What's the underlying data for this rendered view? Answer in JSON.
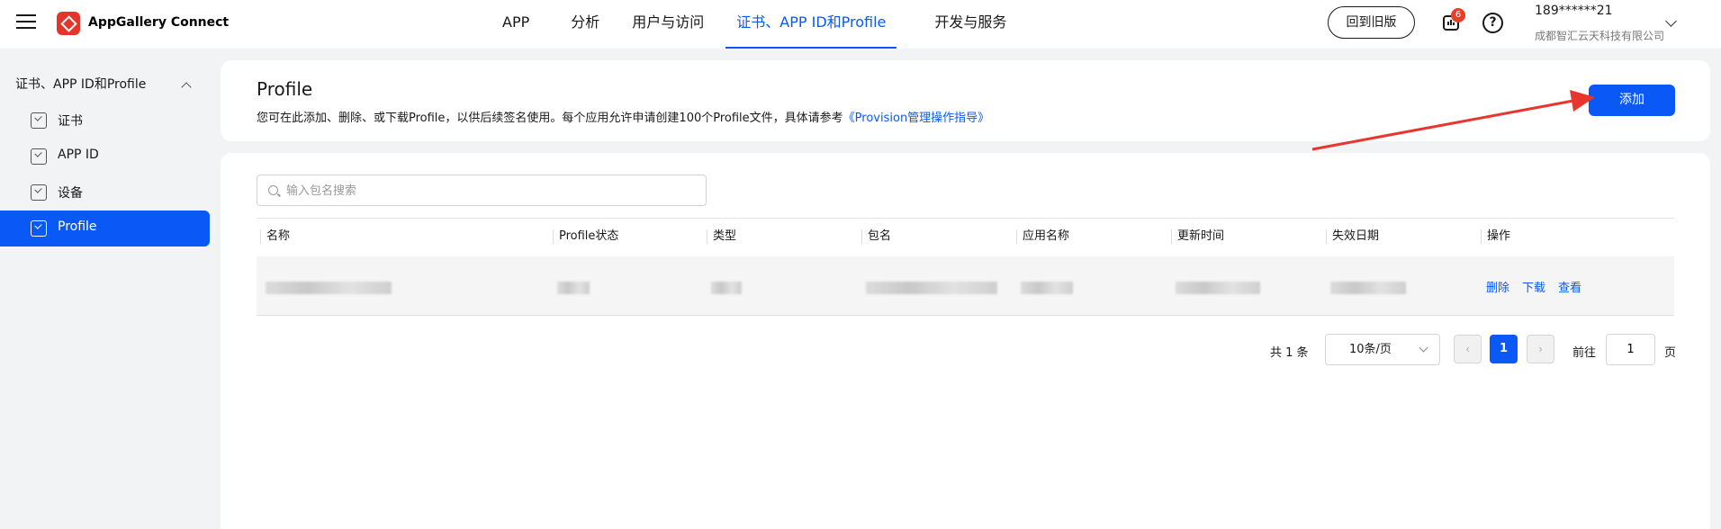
{
  "header": {
    "brand": "AppGallery Connect",
    "nav": [
      "APP",
      "分析",
      "用户与访问",
      "证书、APP ID和Profile",
      "开发与服务"
    ],
    "active_nav_index": 3,
    "old_version_label": "回到旧版",
    "notification_count": "6",
    "help_glyph": "?",
    "user_phone": "189******21",
    "user_company": "成都智汇云天科技有限公司"
  },
  "sidebar": {
    "group_label": "证书、APP ID和Profile",
    "items": [
      {
        "label": "证书",
        "icon": "certificate-icon"
      },
      {
        "label": "APP ID",
        "icon": "app-id-icon"
      },
      {
        "label": "设备",
        "icon": "device-icon"
      },
      {
        "label": "Profile",
        "icon": "profile-icon",
        "active": true
      }
    ]
  },
  "page": {
    "title": "Profile",
    "description": "您可在此添加、删除、或下载Profile，以供后续签名使用。每个应用允许申请创建100个Profile文件，具体请参考",
    "guide_link": "《Provision管理操作指导》",
    "add_label": "添加"
  },
  "search": {
    "placeholder": "输入包名搜索",
    "value": ""
  },
  "table": {
    "headers": [
      "名称",
      "Profile状态",
      "类型",
      "包名",
      "应用名称",
      "更新时间",
      "失效日期",
      "操作"
    ],
    "rows": [
      {
        "actions": [
          "删除",
          "下载",
          "查看"
        ]
      }
    ]
  },
  "pagination": {
    "total_text": "共 1 条",
    "page_size": "10条/页",
    "prev_glyph": "‹",
    "next_glyph": "›",
    "current_page": "1",
    "goto_label": "前往",
    "goto_value": "1",
    "page_unit": "页"
  },
  "colors": {
    "accent": "#0a59f7",
    "brand_logo": "#e3352c",
    "badge": "#e84026",
    "annotation_arrow": "#e8352e"
  }
}
